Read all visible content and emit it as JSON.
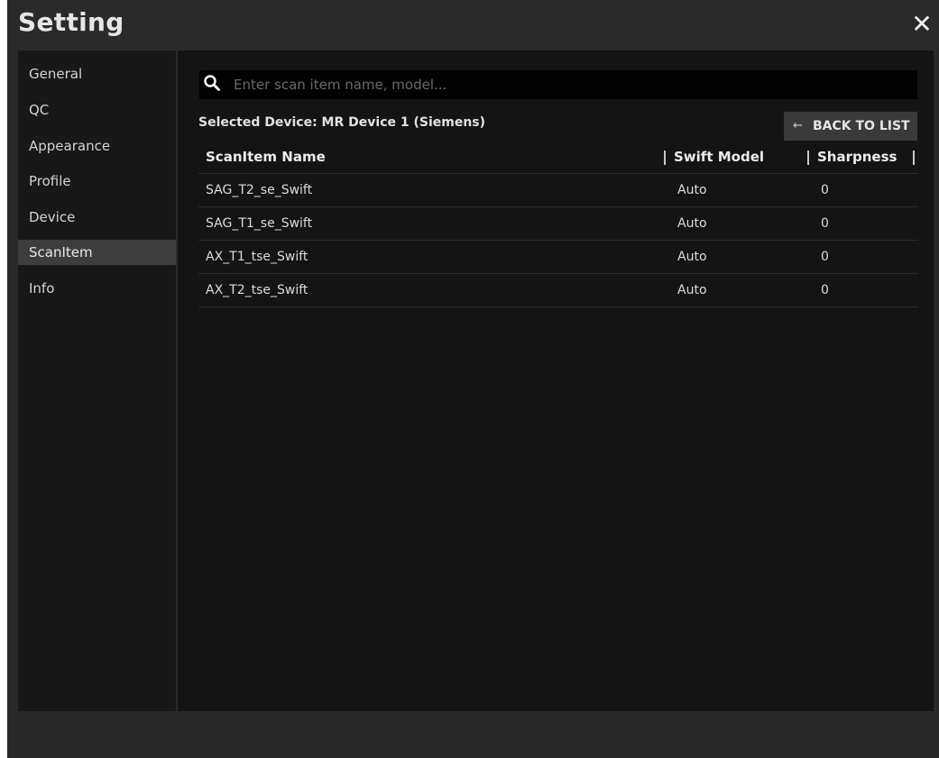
{
  "window": {
    "title": "Setting",
    "close_label": "✕"
  },
  "sidebar": {
    "items": [
      {
        "label": "General"
      },
      {
        "label": "QC"
      },
      {
        "label": "Appearance"
      },
      {
        "label": "Profile"
      },
      {
        "label": "Device"
      },
      {
        "label": "ScanItem",
        "active": true
      },
      {
        "label": "Info"
      }
    ]
  },
  "search": {
    "icon": "search-icon",
    "placeholder": "Enter scan item name, model...",
    "value": ""
  },
  "device": {
    "selected_text": "Selected Device: MR Device 1 (Siemens)"
  },
  "back_button": {
    "arrow": "←",
    "label": "BACK TO LIST"
  },
  "table": {
    "columns": [
      "ScanItem Name",
      "Swift Model",
      "Sharpness"
    ],
    "rows": [
      {
        "name": "SAG_T2_se_Swift",
        "model": "Auto",
        "sharpness": "0"
      },
      {
        "name": "SAG_T1_se_Swift",
        "model": "Auto",
        "sharpness": "0"
      },
      {
        "name": "AX_T1_tse_Swift",
        "model": "Auto",
        "sharpness": "0"
      },
      {
        "name": "AX_T2_tse_Swift",
        "model": "Auto",
        "sharpness": "0"
      }
    ]
  },
  "colors": {
    "background": "#292929",
    "sidebar": "#181818",
    "content": "#141414",
    "active_item": "#3d3d3d",
    "text": "#e0e0e0"
  }
}
